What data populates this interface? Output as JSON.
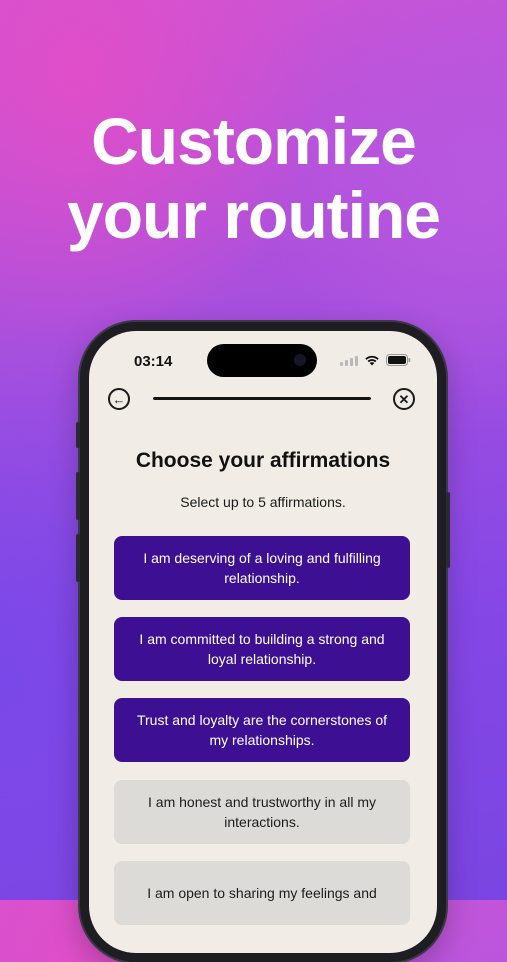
{
  "headline": {
    "line1": "Customize",
    "line2": "your routine"
  },
  "status_bar": {
    "time": "03:14",
    "icons": [
      "signal-icon",
      "wifi-icon",
      "battery-icon"
    ]
  },
  "nav": {
    "back_icon": "arrow-left-icon",
    "close_icon": "close-icon",
    "progress": 1.0
  },
  "screen": {
    "title": "Choose your affirmations",
    "subtitle": "Select up to 5 affirmations."
  },
  "affirmations": [
    {
      "text": "I am deserving of a loving and fulfilling relationship.",
      "selected": true
    },
    {
      "text": "I am committed to building a strong and loyal relationship.",
      "selected": true
    },
    {
      "text": "Trust and loyalty are the cornerstones of my relationships.",
      "selected": true
    },
    {
      "text": "I am honest and trustworthy in all my interactions.",
      "selected": false
    },
    {
      "text": "I am open to sharing my feelings and",
      "selected": false
    }
  ],
  "colors": {
    "selected_bg": "#3d0f92",
    "unselected_bg": "#dcdbd7",
    "screen_bg": "#f1ede6"
  }
}
